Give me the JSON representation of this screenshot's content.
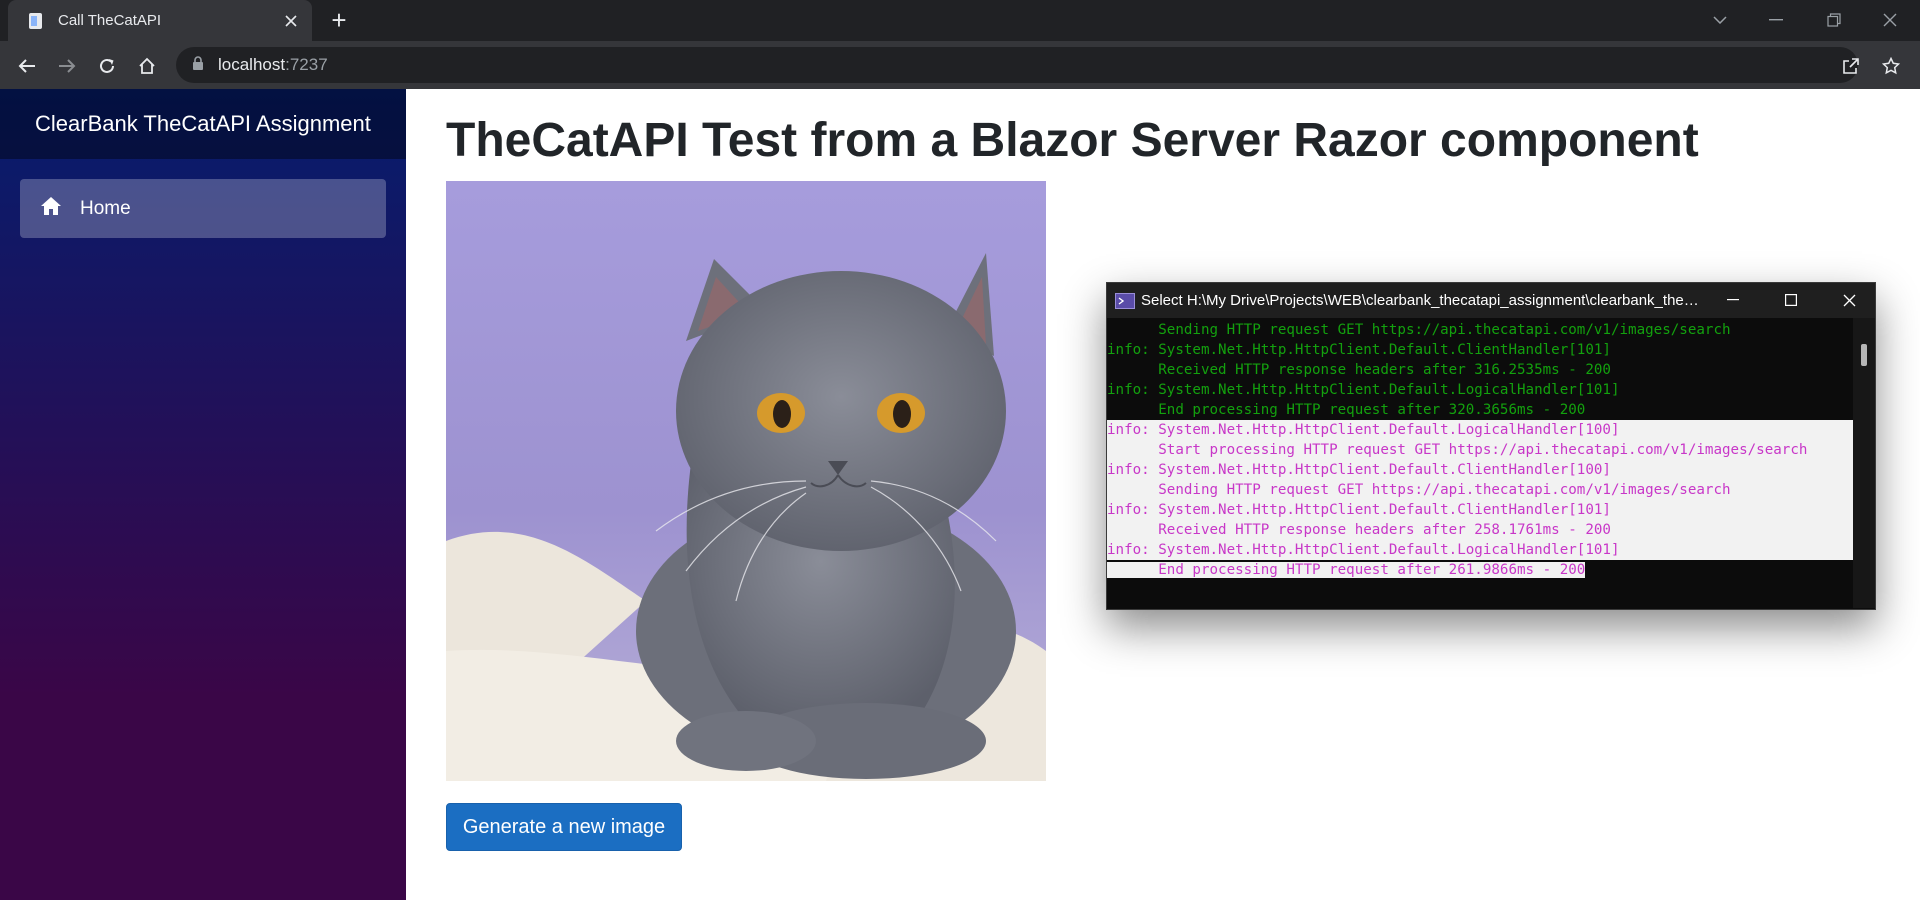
{
  "browser": {
    "tab_title": "Call TheCatAPI",
    "url_host": "localhost",
    "url_port": ":7237"
  },
  "sidebar": {
    "brand": "ClearBank TheCatAPI Assignment",
    "items": [
      {
        "label": "Home",
        "icon": "home-icon"
      }
    ]
  },
  "main": {
    "title": "TheCatAPI Test from a Blazor Server Razor component",
    "image_icon": "cat-photo",
    "generate_label": "Generate a new image"
  },
  "console": {
    "title": "Select H:\\My Drive\\Projects\\WEB\\clearbank_thecatapi_assignment\\clearbank_theca...",
    "lines": [
      {
        "text": "      Sending HTTP request GET https://api.thecatapi.com/v1/images/search",
        "style": "green"
      },
      {
        "text": "info: System.Net.Http.HttpClient.Default.ClientHandler[101]",
        "style": "green"
      },
      {
        "text": "      Received HTTP response headers after 316.2535ms - 200",
        "style": "green"
      },
      {
        "text": "info: System.Net.Http.HttpClient.Default.LogicalHandler[101]",
        "style": "green"
      },
      {
        "text": "      End processing HTTP request after 320.3656ms - 200",
        "style": "green"
      },
      {
        "text": "info: System.Net.Http.HttpClient.Default.LogicalHandler[100]",
        "style": "magenta"
      },
      {
        "text": "      Start processing HTTP request GET https://api.thecatapi.com/v1/images/search",
        "style": "magenta"
      },
      {
        "text": "info: System.Net.Http.HttpClient.Default.ClientHandler[100]",
        "style": "magenta"
      },
      {
        "text": "      Sending HTTP request GET https://api.thecatapi.com/v1/images/search",
        "style": "magenta"
      },
      {
        "text": "info: System.Net.Http.HttpClient.Default.ClientHandler[101]",
        "style": "magenta"
      },
      {
        "text": "      Received HTTP response headers after 258.1761ms - 200",
        "style": "magenta"
      },
      {
        "text": "info: System.Net.Http.HttpClient.Default.LogicalHandler[101]",
        "style": "magenta"
      },
      {
        "text": "      End processing HTTP request after 261.9866ms - 200",
        "style": "magenta-partial"
      }
    ]
  },
  "colors": {
    "accent": "#1b6ec2",
    "console_green": "#13a10e",
    "console_magenta": "#c837c8"
  }
}
